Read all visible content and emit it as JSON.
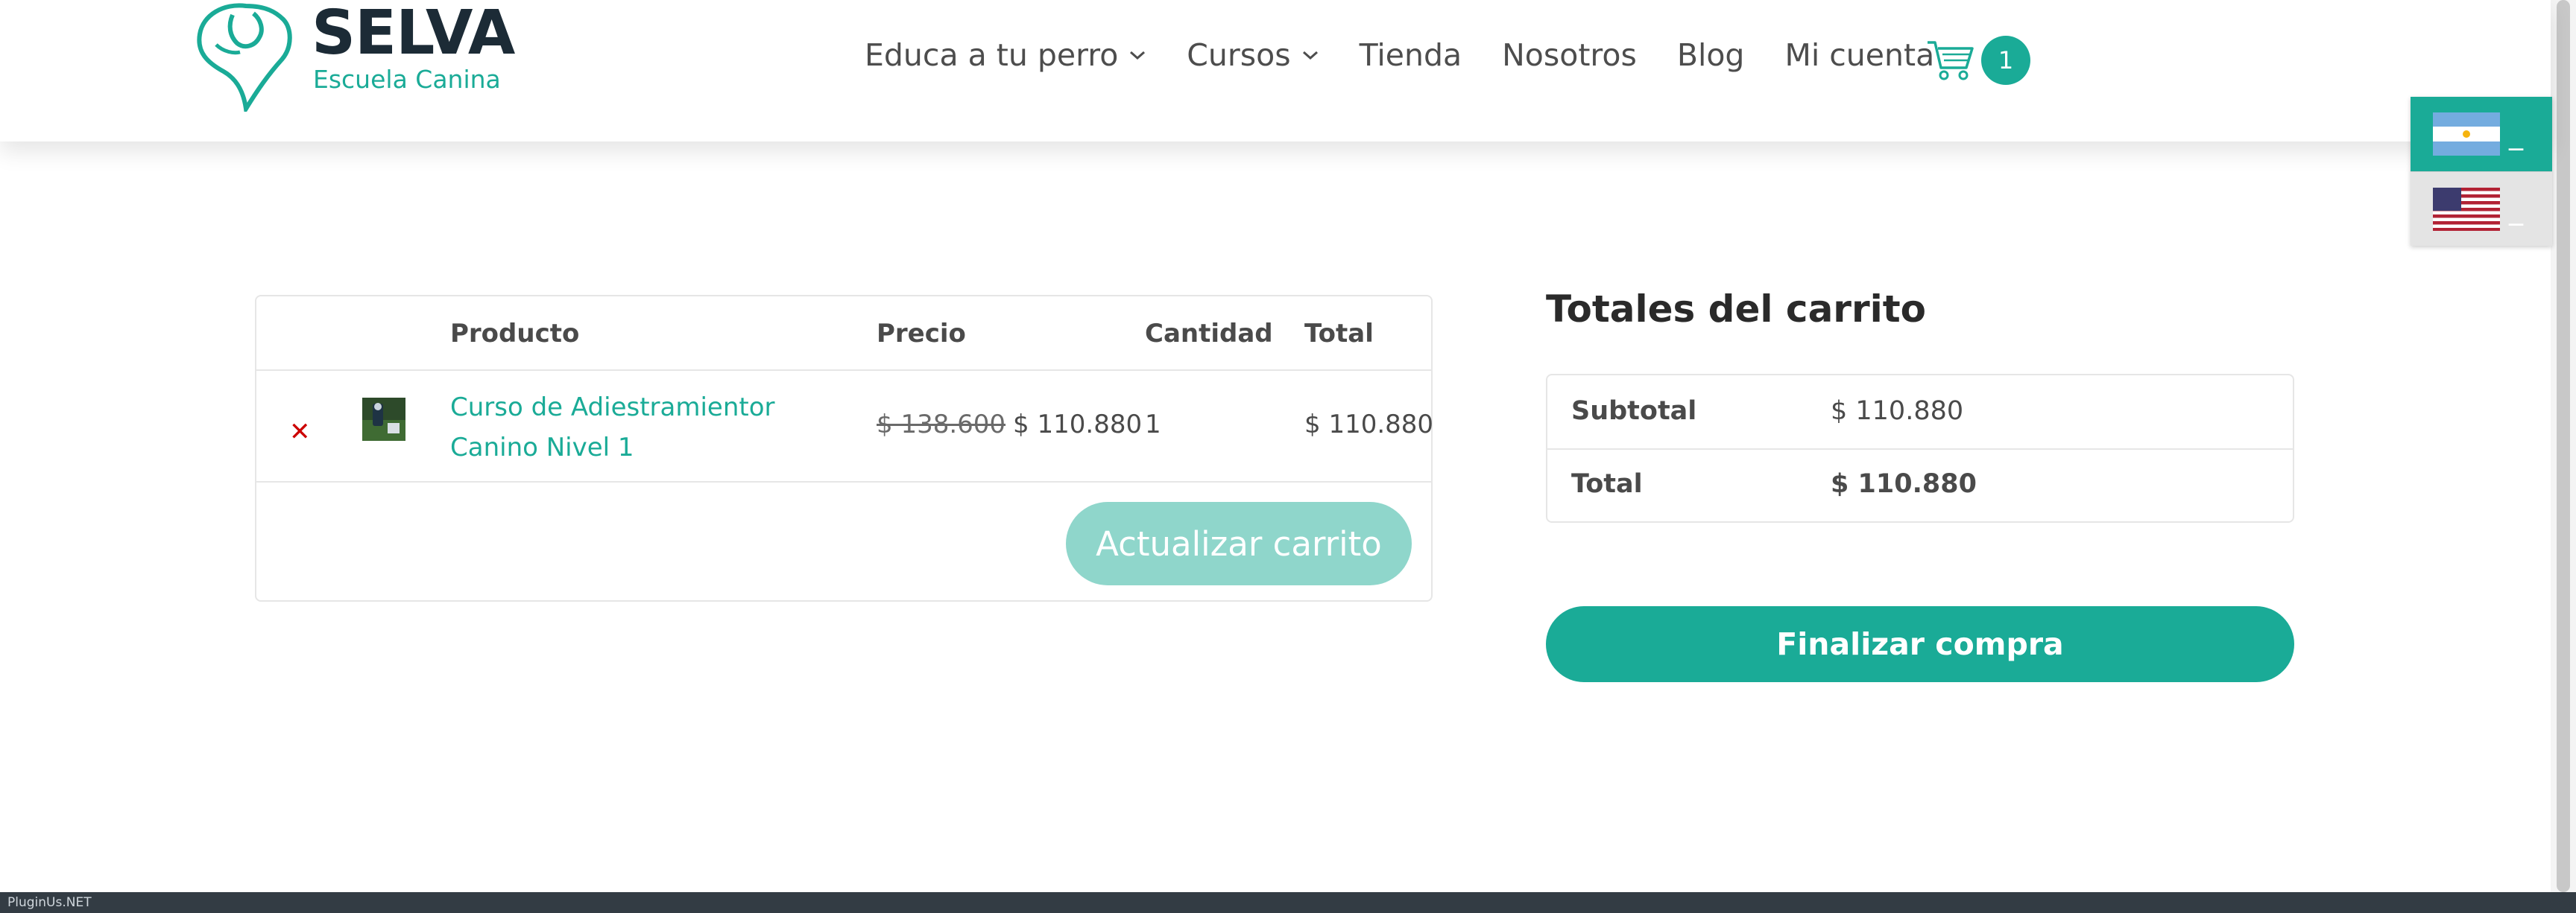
{
  "brand": {
    "title": "SELVA",
    "subtitle": "Escuela Canina",
    "accent": "#1aab97"
  },
  "nav": {
    "items": [
      {
        "label": "Educa a tu perro",
        "dropdown": true
      },
      {
        "label": "Cursos",
        "dropdown": true
      },
      {
        "label": "Tienda",
        "dropdown": false
      },
      {
        "label": "Nosotros",
        "dropdown": false
      },
      {
        "label": "Blog",
        "dropdown": false
      },
      {
        "label": "Mi cuenta",
        "dropdown": false
      }
    ],
    "cart_count": "1"
  },
  "language_switcher": {
    "items": [
      {
        "flag": "argentina-flag-icon",
        "label": "_"
      },
      {
        "flag": "usa-flag-icon",
        "label": "_"
      }
    ]
  },
  "cart": {
    "headers": {
      "product": "Producto",
      "price": "Precio",
      "quantity": "Cantidad",
      "total": "Total"
    },
    "items": [
      {
        "name": "Curso de Adiestramientor Canino Nivel 1",
        "old_price": "$ 138.600",
        "price": "$ 110.880",
        "quantity": "1",
        "total": "$ 110.880"
      }
    ],
    "remove_icon": "remove-x-icon",
    "update_label": "Actualizar carrito"
  },
  "totals": {
    "title": "Totales del carrito",
    "subtotal_label": "Subtotal",
    "subtotal_value": "$ 110.880",
    "total_label": "Total",
    "total_value": "$ 110.880",
    "checkout_label": "Finalizar compra"
  },
  "footer": {
    "text": "PluginUs.NET"
  }
}
